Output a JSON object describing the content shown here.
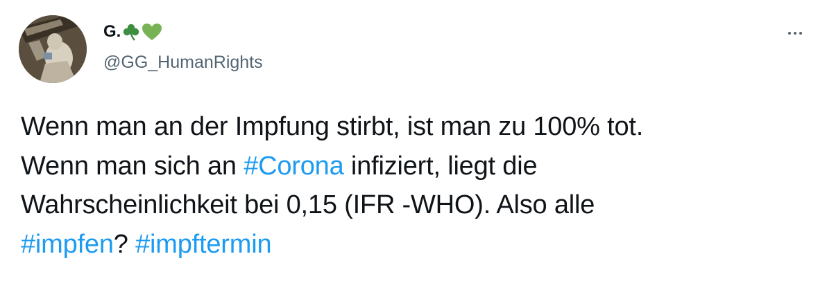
{
  "author": {
    "display_name": "G.",
    "name_emojis": [
      "shamrock-icon",
      "green-heart-icon"
    ],
    "handle": "@GG_HumanRights"
  },
  "more_menu": {
    "icon": "more-horizontal-icon"
  },
  "tweet": {
    "line1": "Wenn man an der Impfung stirbt, ist man zu 100% tot.",
    "line2_pre": "Wenn man sich an ",
    "hashtag_corona": "#Corona",
    "line2_post": " infiziert, liegt die",
    "line3": "Wahrscheinlichkeit bei 0,15 (IFR -WHO). Also alle",
    "hashtag_impfen": "#impfen",
    "line4_mid": "? ",
    "hashtag_impftermin": "#impftermin"
  },
  "colors": {
    "text": "#0f1419",
    "secondary": "#536471",
    "link": "#1d9bf0",
    "shamrock": "#3e8e41",
    "heart": "#77b255"
  }
}
